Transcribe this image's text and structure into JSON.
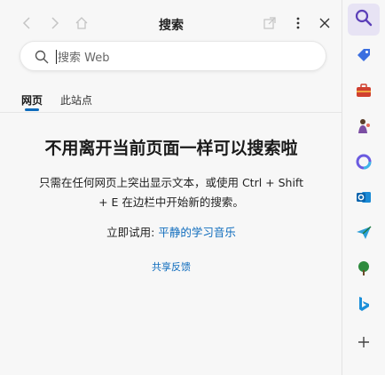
{
  "header": {
    "title": "搜索"
  },
  "search": {
    "placeholder": "搜索 Web"
  },
  "tabs": [
    {
      "label": "网页",
      "active": true
    },
    {
      "label": "此站点",
      "active": false
    }
  ],
  "main": {
    "headline": "不用离开当前页面一样可以搜索啦",
    "description": "只需在任何网页上突出显示文本，或使用 Ctrl + Shift + E 在边栏中开始新的搜索。",
    "try_prefix": "立即试用: ",
    "try_link": "平静的学习音乐",
    "share_link": "共享反馈"
  },
  "rail": {
    "items": [
      "search-icon",
      "shopping-tag-icon",
      "tools-icon",
      "games-icon",
      "copilot-icon",
      "outlook-icon",
      "send-icon",
      "tree-icon",
      "bing-icon",
      "add-icon"
    ]
  },
  "colors": {
    "accent": "#0f6cbd",
    "active_rail": "#e7e3f4"
  }
}
